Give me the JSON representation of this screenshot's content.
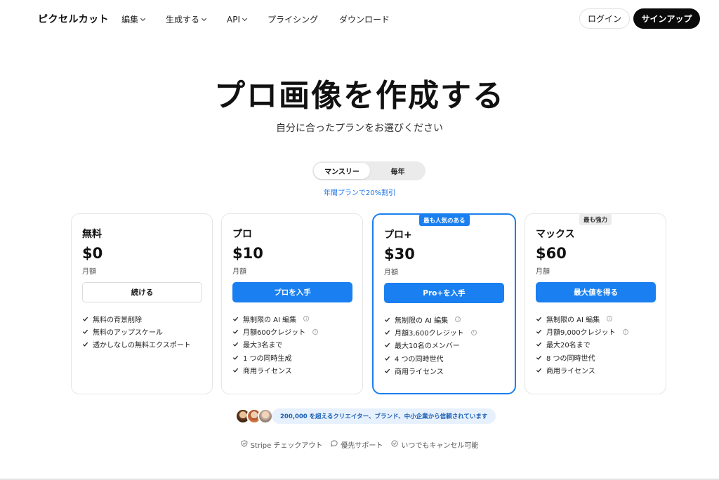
{
  "nav": {
    "logo": "ピクセルカット",
    "links": [
      {
        "label": "編集",
        "dropdown": true
      },
      {
        "label": "生成する",
        "dropdown": true
      },
      {
        "label": "API",
        "dropdown": true
      },
      {
        "label": "プライシング",
        "dropdown": false
      },
      {
        "label": "ダウンロード",
        "dropdown": false
      }
    ],
    "login": "ログイン",
    "signup": "サインアップ"
  },
  "hero": {
    "title": "プロ画像を作成する",
    "subtitle": "自分に合ったプランをお選びください"
  },
  "billing": {
    "monthly": "マンスリー",
    "yearly": "毎年",
    "selected": "マンスリー",
    "discount_note": "年間プランで20%割引"
  },
  "plans": [
    {
      "name": "無料",
      "price": "$0",
      "period": "月額",
      "button": "続ける",
      "features": [
        "無料の背景削除",
        "無料のアップスケール",
        "透かしなしの無料エクスポート"
      ]
    },
    {
      "name": "プロ",
      "price": "$10",
      "period": "月額",
      "button": "プロを入手",
      "features": [
        "無制限の AI 編集",
        "月額600クレジット",
        "最大3名まで",
        "1 つの同時生成",
        "商用ライセンス"
      ]
    },
    {
      "name": "プロ+",
      "price": "$30",
      "period": "月額",
      "button": "Pro+を入手",
      "badge": "最も人気のある",
      "features": [
        "無制限の AI 編集",
        "月額3,600クレジット",
        "最大10名のメンバー",
        "4 つの同時世代",
        "商用ライセンス"
      ]
    },
    {
      "name": "マックス",
      "price": "$60",
      "period": "月額",
      "button": "最大値を得る",
      "badge": "最も強力",
      "features": [
        "無制限の AI 編集",
        "月額9,000クレジット",
        "最大20名まで",
        "8 つの同時世代",
        "商用ライセンス"
      ]
    }
  ],
  "trust": {
    "text": "200,000 を超えるクリエイター、ブランド、中小企業から信頼されています"
  },
  "notes": [
    {
      "icon": "shield-icon",
      "label": "Stripe チェックアウト"
    },
    {
      "icon": "chat-icon",
      "label": "優先サポート"
    },
    {
      "icon": "clock-icon",
      "label": "いつでもキャンセル可能"
    }
  ],
  "colors": {
    "accent": "#1a7ff0",
    "dark": "#0a0a0a",
    "trust_bg": "#e7f1fd"
  }
}
